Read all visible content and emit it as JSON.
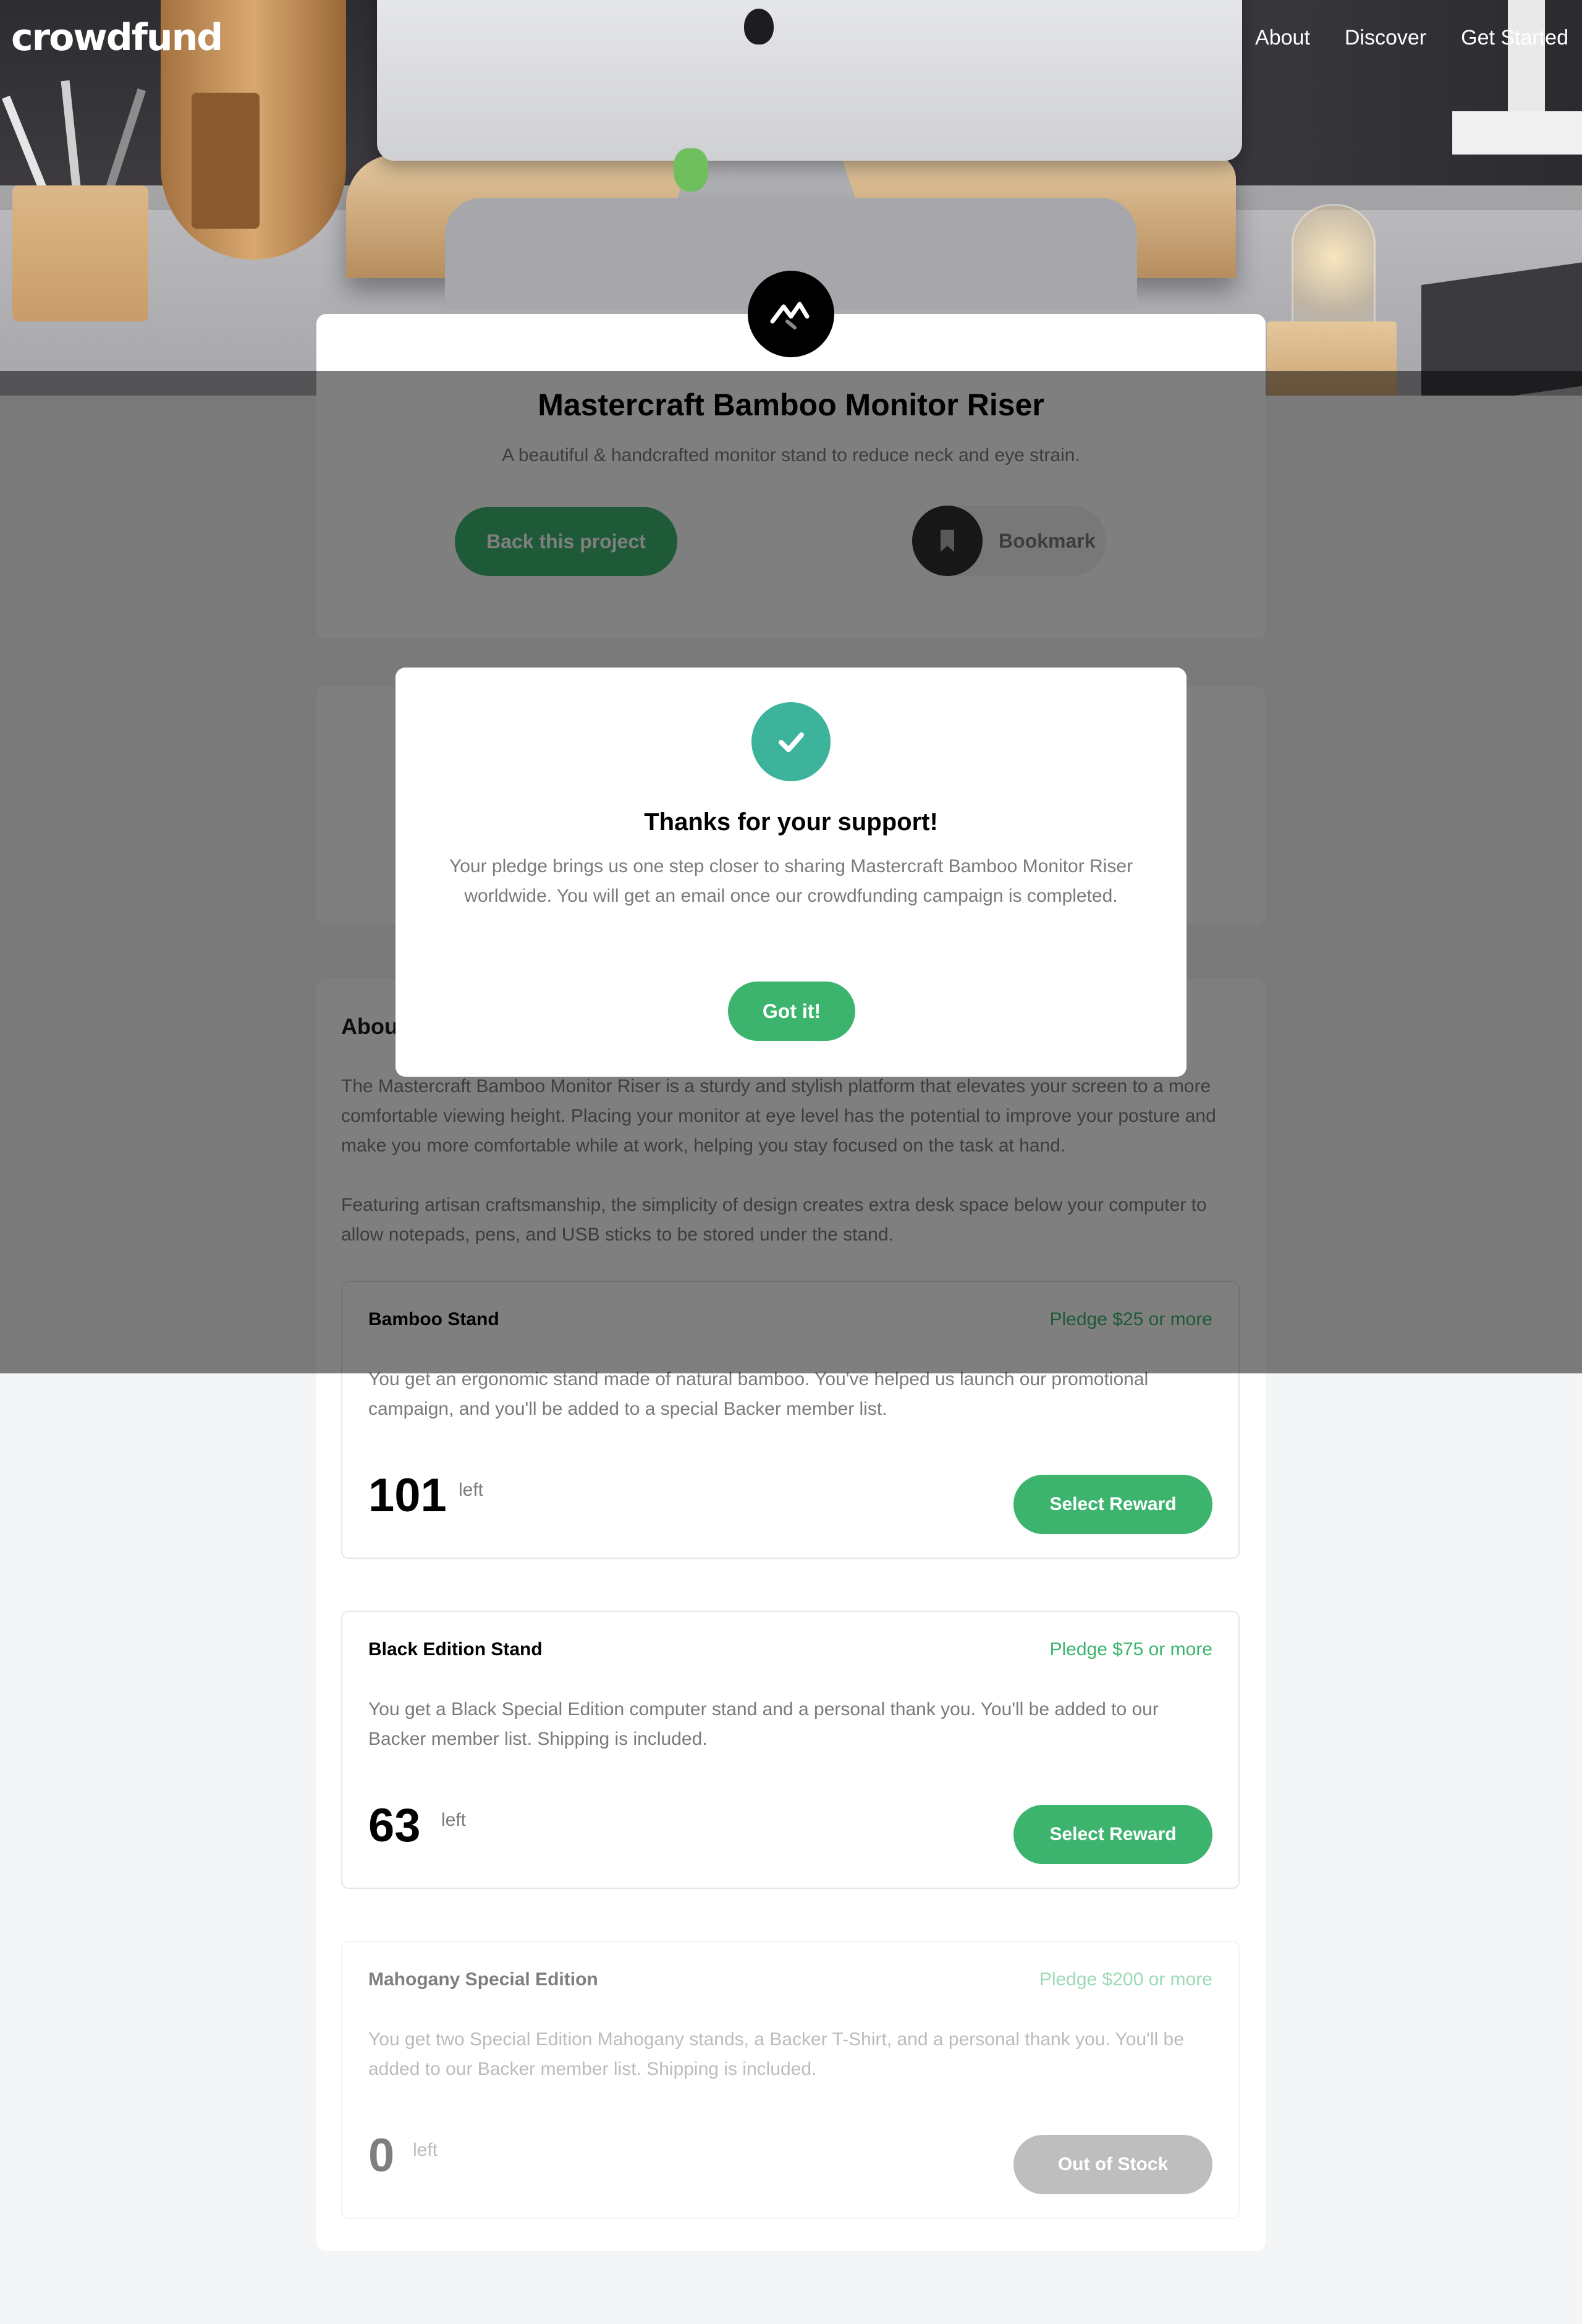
{
  "header": {
    "logo": "crowdfund",
    "nav": [
      "About",
      "Discover",
      "Get Started"
    ]
  },
  "project": {
    "title": "Mastercraft Bamboo Monitor Riser",
    "description": "A beautiful & handcrafted monitor stand to reduce neck and eye strain.",
    "back_label": "Back this project",
    "bookmark_label": "Bookmark"
  },
  "about": {
    "heading": "About this project",
    "paragraphs": [
      "The Mastercraft Bamboo Monitor Riser is a sturdy and stylish platform that elevates your screen to a more comfortable viewing height. Placing your monitor at eye level has the potential to improve your posture and make you more comfortable while at work, helping you stay focused on the task at hand.",
      "Featuring artisan craftsmanship, the simplicity of design creates extra desk space below your computer to allow notepads, pens, and USB sticks to be stored under the stand."
    ]
  },
  "rewards": [
    {
      "name": "Bamboo Stand",
      "pledge": "Pledge $25 or more",
      "description": "You get an ergonomic stand made of natural bamboo. You've helped us launch our promotional campaign, and you'll be added to a special Backer member list.",
      "left": "101",
      "left_word": "left",
      "button": "Select Reward"
    },
    {
      "name": "Black Edition Stand",
      "pledge": "Pledge $75 or more",
      "description": "You get a Black Special Edition computer stand and a personal thank you. You'll be added to our Backer member list. Shipping is included.",
      "left": "63",
      "left_word": "left",
      "button": "Select Reward"
    },
    {
      "name": "Mahogany Special Edition",
      "pledge": "Pledge $200 or more",
      "description": "You get two Special Edition Mahogany stands, a Backer T-Shirt, and a personal thank you. You'll be added to our Backer member list. Shipping is included.",
      "left": "0",
      "left_word": "left",
      "button": "Out of Stock"
    }
  ],
  "modal": {
    "title": "Thanks for your support!",
    "text": "Your pledge brings us one step closer to sharing Mastercraft Bamboo Monitor Riser worldwide. You will get an email once our crowdfunding campaign is completed.",
    "button": "Got it!"
  },
  "colors": {
    "accent": "#3cb46e",
    "accent_teal": "#3cb39a",
    "text_muted": "#7a7a7a",
    "overlay": "rgba(0,0,0,0.5)"
  },
  "icons": {
    "check": "check-icon",
    "bookmark": "bookmark-icon",
    "brand": "brand-logo-icon"
  }
}
